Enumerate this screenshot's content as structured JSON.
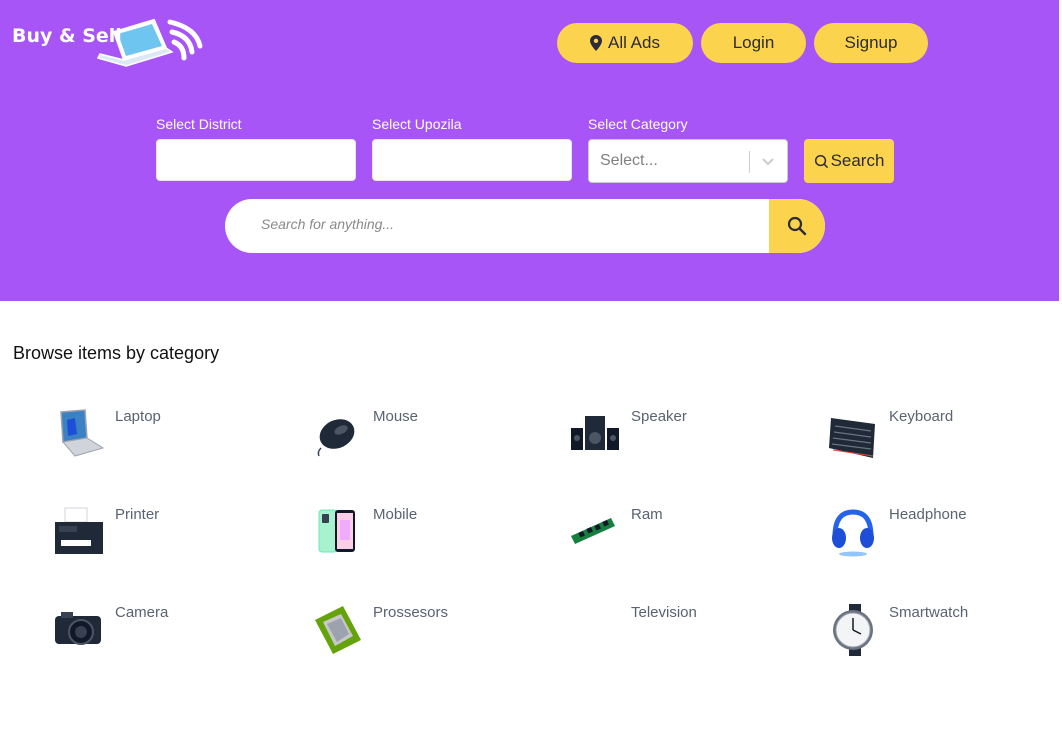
{
  "header": {
    "logo_text": "Buy & Sell",
    "nav": {
      "all_ads_label": "All Ads",
      "login_label": "Login",
      "signup_label": "Signup"
    }
  },
  "filters": {
    "district_label": "Select District",
    "district_value": "",
    "upozila_label": "Select Upozila",
    "upozila_value": "",
    "category_label": "Select Category",
    "category_placeholder": "Select...",
    "search_button_label": "Search"
  },
  "search": {
    "placeholder": "Search for anything..."
  },
  "categories_section": {
    "title": "Browse items by category",
    "items": [
      {
        "label": "Laptop",
        "icon": "laptop-icon"
      },
      {
        "label": "Mouse",
        "icon": "mouse-icon"
      },
      {
        "label": "Speaker",
        "icon": "speaker-icon"
      },
      {
        "label": "Keyboard",
        "icon": "keyboard-icon"
      },
      {
        "label": "Printer",
        "icon": "printer-icon"
      },
      {
        "label": "Mobile",
        "icon": "mobile-icon"
      },
      {
        "label": "Ram",
        "icon": "ram-icon"
      },
      {
        "label": "Headphone",
        "icon": "headphone-icon"
      },
      {
        "label": "Camera",
        "icon": "camera-icon"
      },
      {
        "label": "Prossesors",
        "icon": "processor-icon"
      },
      {
        "label": "Television",
        "icon": ""
      },
      {
        "label": "Smartwatch",
        "icon": "smartwatch-icon"
      }
    ]
  },
  "colors": {
    "header_bg": "#a855f7",
    "accent": "#fcd34d",
    "label_text": "#5b6370"
  }
}
